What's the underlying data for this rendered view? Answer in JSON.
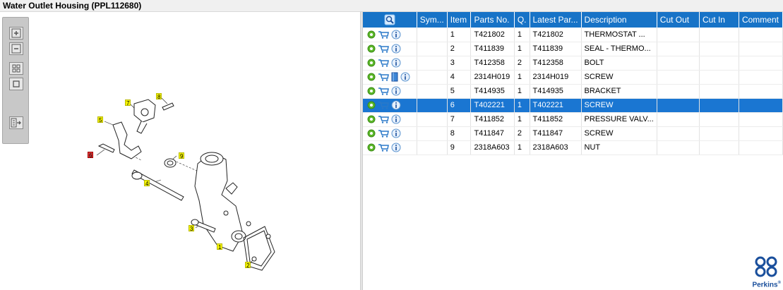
{
  "window": {
    "title": "Water Outlet Housing (PPL112680)"
  },
  "toolbar": {
    "buttons": [
      {
        "name": "zoom-in",
        "icon": "zoom-in-icon"
      },
      {
        "name": "zoom-out",
        "icon": "zoom-out-icon"
      },
      {
        "name": "zoom-region",
        "icon": "grid-icon"
      },
      {
        "name": "fit-page",
        "icon": "square-icon"
      },
      {
        "name": "export",
        "icon": "export-icon"
      }
    ]
  },
  "diagram": {
    "callouts": [
      "1",
      "2",
      "3",
      "4",
      "5",
      "6",
      "7",
      "8",
      "9"
    ]
  },
  "table": {
    "headers": [
      "",
      "Sym...",
      "Item",
      "Parts No.",
      "Q.",
      "Latest Par...",
      "Description",
      "Cut Out",
      "Cut In",
      "Comment"
    ],
    "rows": [
      {
        "item": "1",
        "part": "T421802",
        "qty": "1",
        "latest": "T421802",
        "desc": "THERMOSTAT ...",
        "book": false
      },
      {
        "item": "2",
        "part": "T411839",
        "qty": "1",
        "latest": "T411839",
        "desc": "SEAL - THERMO...",
        "book": false
      },
      {
        "item": "3",
        "part": "T412358",
        "qty": "2",
        "latest": "T412358",
        "desc": "BOLT",
        "book": false
      },
      {
        "item": "4",
        "part": "2314H019",
        "qty": "1",
        "latest": "2314H019",
        "desc": "SCREW",
        "book": true
      },
      {
        "item": "5",
        "part": "T414935",
        "qty": "1",
        "latest": "T414935",
        "desc": "BRACKET",
        "book": false
      },
      {
        "item": "6",
        "part": "T402221",
        "qty": "1",
        "latest": "T402221",
        "desc": "SCREW",
        "book": false
      },
      {
        "item": "7",
        "part": "T411852",
        "qty": "1",
        "latest": "T411852",
        "desc": "PRESSURE VALV...",
        "book": false
      },
      {
        "item": "8",
        "part": "T411847",
        "qty": "2",
        "latest": "T411847",
        "desc": "SCREW",
        "book": false
      },
      {
        "item": "9",
        "part": "2318A603",
        "qty": "1",
        "latest": "2318A603",
        "desc": "NUT",
        "book": false
      }
    ],
    "selected_row": 5
  },
  "branding": {
    "logo_text": "Perkins",
    "logo_mark": "®"
  },
  "colors": {
    "header_blue": "#1773c7",
    "selected_blue": "#1a76d2",
    "callout_yellow": "#f6f600",
    "callout_red": "#e23b3b"
  }
}
